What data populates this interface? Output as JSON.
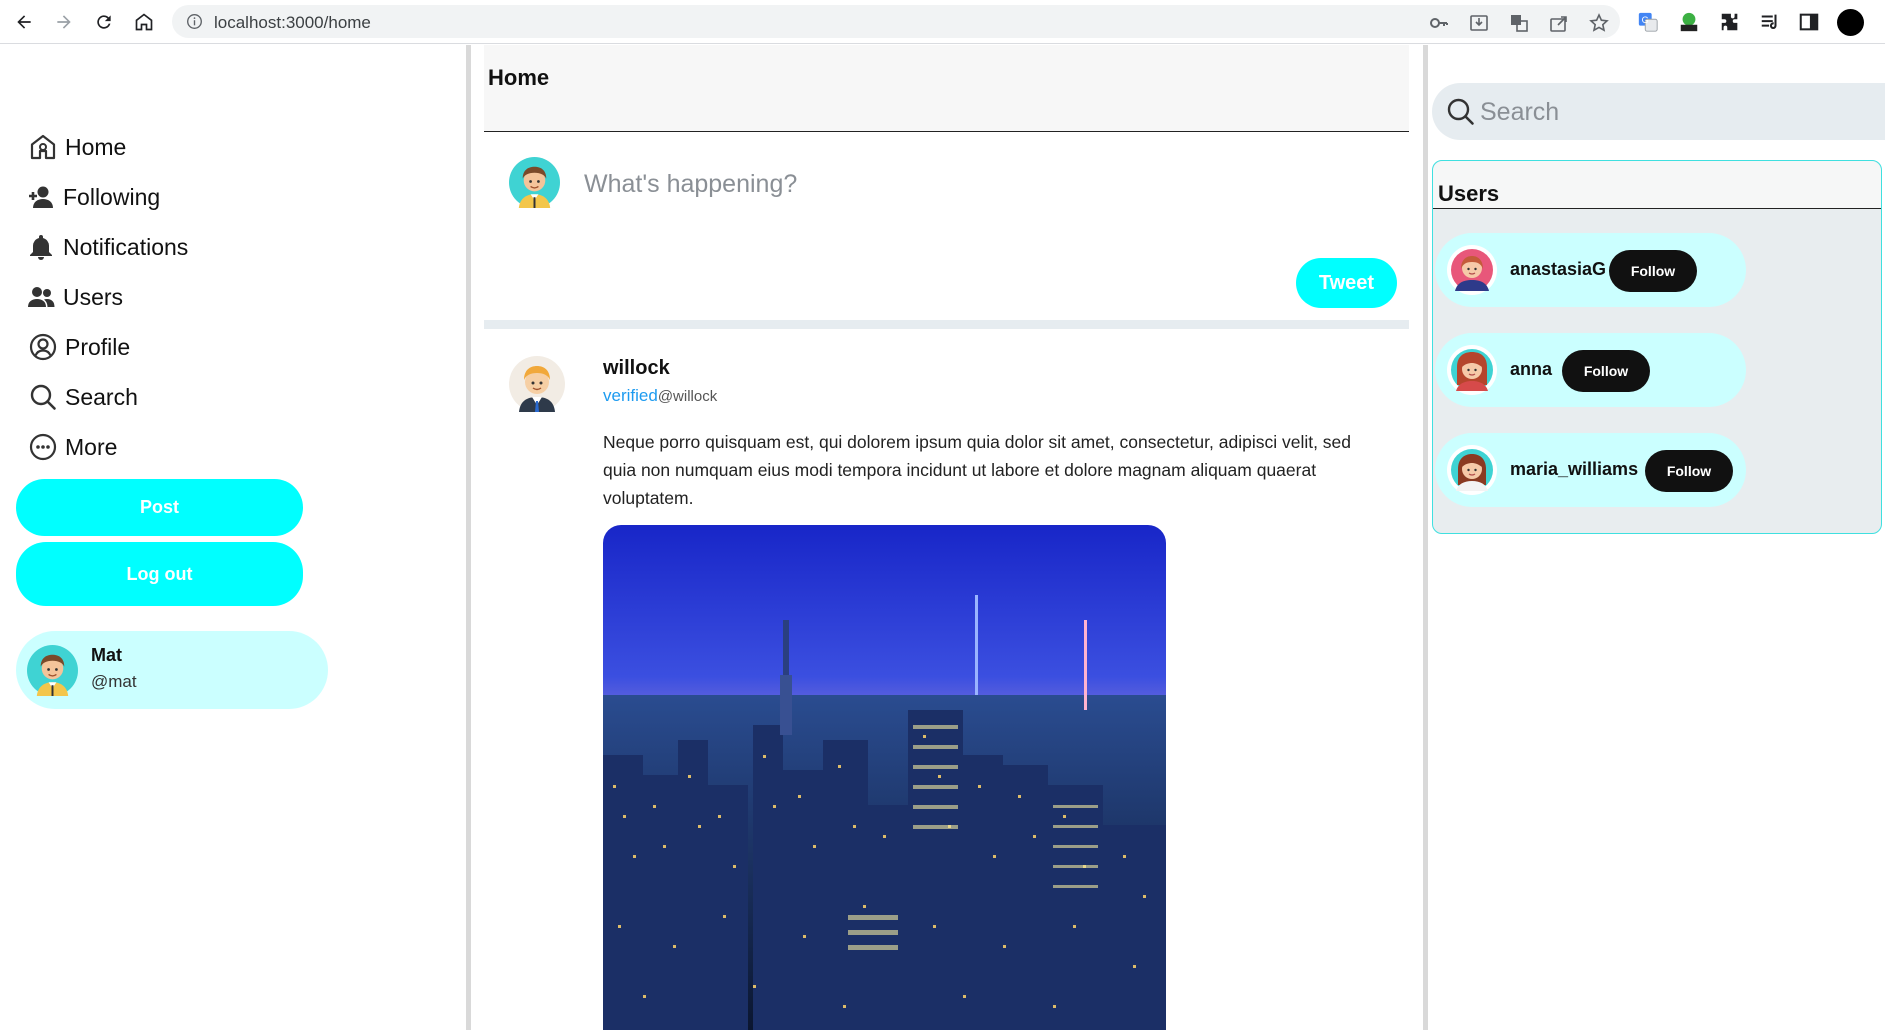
{
  "browser": {
    "url": "localhost:3000/home"
  },
  "sidebar": {
    "items": [
      {
        "label": "Home",
        "icon": "home-icon"
      },
      {
        "label": "Following",
        "icon": "user-plus-icon"
      },
      {
        "label": "Notifications",
        "icon": "bell-icon"
      },
      {
        "label": "Users",
        "icon": "users-icon"
      },
      {
        "label": "Profile",
        "icon": "user-circle-icon"
      },
      {
        "label": "Search",
        "icon": "search-icon"
      },
      {
        "label": "More",
        "icon": "more-icon"
      }
    ],
    "post_label": "Post",
    "logout_label": "Log out",
    "me": {
      "name": "Mat",
      "handle": "@mat"
    }
  },
  "main": {
    "title": "Home",
    "composer": {
      "placeholder": "What's happening?",
      "button": "Tweet"
    },
    "post": {
      "name": "willock",
      "verified": "verified",
      "handle": "@willock",
      "body": "Neque porro quisquam est, qui dolorem ipsum quia dolor sit amet, consectetur, adipisci velit, sed quia non numquam eius modi tempora incidunt ut labore et dolore magnam aliquam quaerat voluptatem."
    }
  },
  "right": {
    "search_placeholder": "Search",
    "users_title": "Users",
    "users": [
      {
        "name": "anastasiaG",
        "follow": "Follow"
      },
      {
        "name": "anna",
        "follow": "Follow"
      },
      {
        "name": "maria_williams",
        "follow": "Follow"
      }
    ]
  },
  "colors": {
    "accent": "#00ffff",
    "card_bg": "#cbffff",
    "follow_bg": "#111111",
    "verified": "#1d9bf0"
  }
}
